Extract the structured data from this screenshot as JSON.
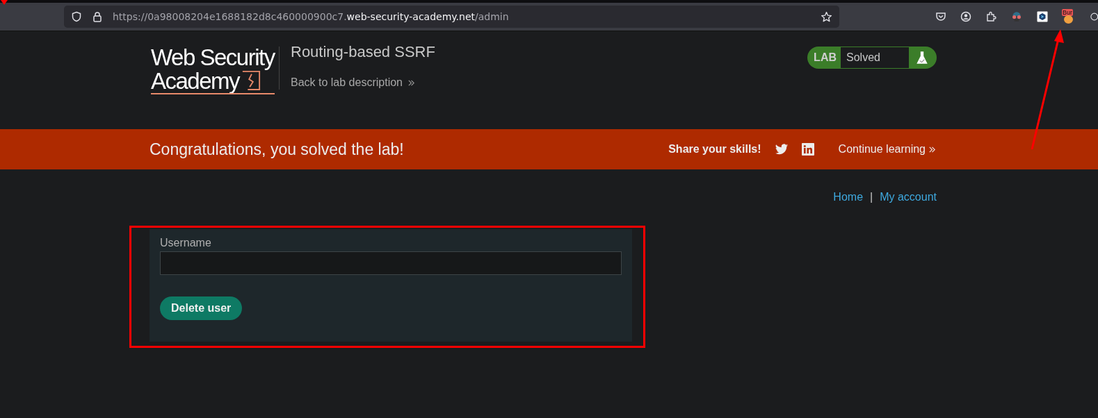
{
  "browser": {
    "url": {
      "prefix": "https://0a98008204e1688182d8c460000900c7.",
      "domain": "web-security-academy.net",
      "path": "/admin"
    },
    "extension_badge": "Bur"
  },
  "header": {
    "logo": {
      "line_1": "Web Security",
      "line_2": "Academy"
    },
    "lab_title": "Routing-based SSRF",
    "back_link": "Back to lab description",
    "status": {
      "label": "LAB",
      "value": "Solved",
      "solved": true
    }
  },
  "banner": {
    "message": "Congratulations, you solved the lab!",
    "share": "Share your skills!",
    "continue": "Continue learning"
  },
  "nav": {
    "links": [
      "Home",
      "My account"
    ],
    "separator": "|"
  },
  "form": {
    "label": "Username",
    "button": "Delete user"
  }
}
